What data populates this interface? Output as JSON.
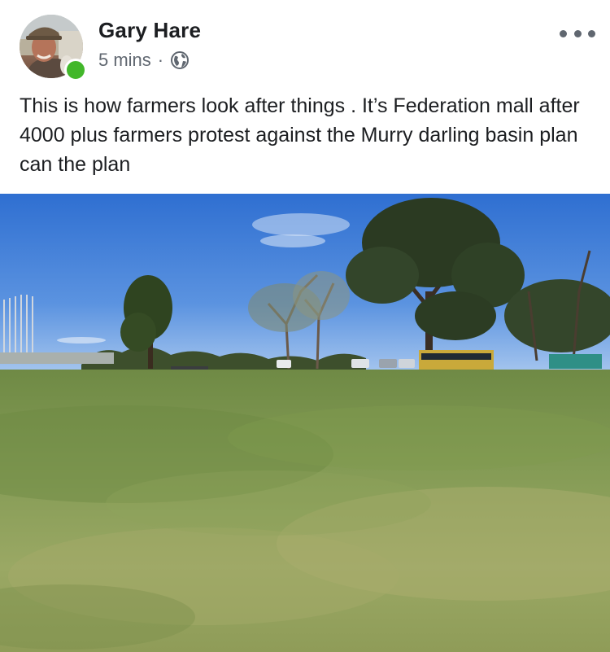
{
  "post": {
    "author": "Gary Hare",
    "timestamp": "5 mins",
    "separator": "·",
    "privacy_icon": "globe-icon",
    "more_icon": "more-options-icon",
    "text": "This is how farmers look after things . It’s Federation mall after 4000 plus farmers protest against the Murry darling basin plan can the plan",
    "online_status_color": "#42b72a"
  },
  "photo": {
    "subject": "park-lawn-photo"
  }
}
